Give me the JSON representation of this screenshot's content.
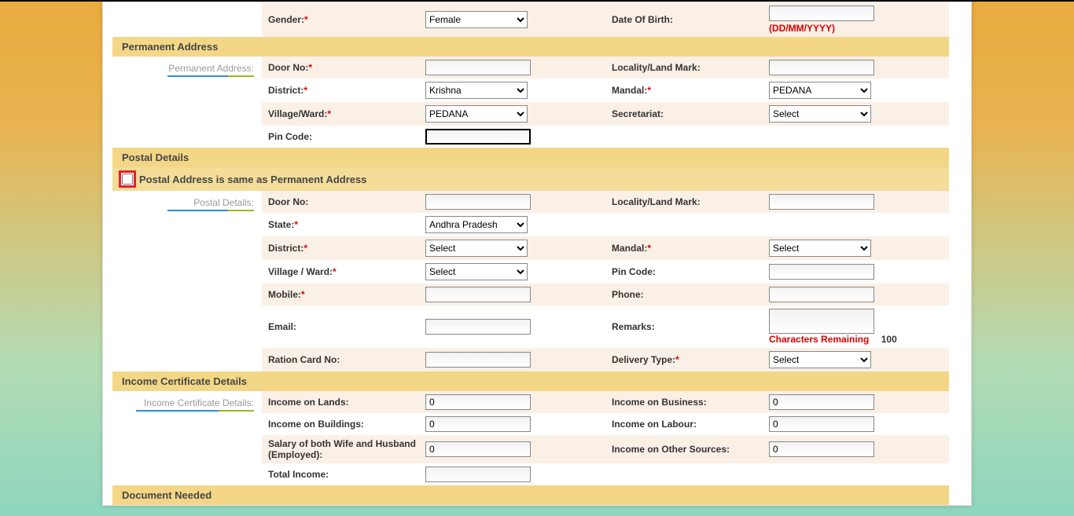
{
  "top": {
    "gender_label": "Gender:",
    "gender_value": "Female",
    "dob_label": "Date Of Birth:",
    "dob_hint": "(DD/MM/YYYY)"
  },
  "perm": {
    "section": "Permanent Address",
    "side": "Permanent Address:",
    "door": "Door No:",
    "locality": "Locality/Land Mark:",
    "district": "District:",
    "district_val": "Krishna",
    "mandal": "Mandal:",
    "mandal_val": "PEDANA",
    "village": "Village/Ward:",
    "village_val": "PEDANA",
    "secretariat": "Secretariat:",
    "secretariat_val": "Select",
    "pincode": "Pin Code:"
  },
  "postal": {
    "section": "Postal Details",
    "same": "Postal Address is same as Permanent Address",
    "side": "Postal Details:",
    "door": "Door No:",
    "locality": "Locality/Land Mark:",
    "state": "State:",
    "state_val": "Andhra Pradesh",
    "district": "District:",
    "district_val": "Select",
    "mandal": "Mandal:",
    "mandal_val": "Select",
    "village": "Village / Ward:",
    "village_val": "Select",
    "pincode": "Pin Code:",
    "mobile": "Mobile:",
    "phone": "Phone:",
    "email": "Email:",
    "remarks": "Remarks:",
    "remarks_label": "Characters Remaining",
    "remarks_count": "100",
    "ration": "Ration Card No:",
    "delivery": "Delivery Type:",
    "delivery_val": "Select"
  },
  "income": {
    "section": "Income Certificate Details",
    "side": "Income Certificate Details:",
    "lands": "Income on Lands:",
    "business": "Income on Business:",
    "buildings": "Income on Buildings:",
    "labour": "Income on Labour:",
    "salary": "Salary of both Wife and Husband (Employed):",
    "other": "Income on Other Sources:",
    "total": "Total Income:",
    "zero": "0"
  },
  "docs": {
    "section": "Document Needed"
  }
}
